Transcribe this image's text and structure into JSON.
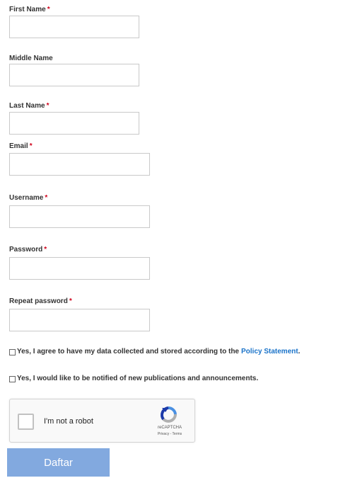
{
  "form": {
    "first_name_label": "First Name",
    "middle_name_label": "Middle Name",
    "last_name_label": "Last Name",
    "email_label": "Email",
    "username_label": "Username",
    "password_label": "Password",
    "repeat_password_label": "Repeat password",
    "required_mark": "*",
    "first_name_value": "",
    "middle_name_value": "",
    "last_name_value": "",
    "email_value": "",
    "username_value": "",
    "password_value": "",
    "repeat_password_value": ""
  },
  "consent": {
    "privacy_text": "Yes, I agree to have my data collected and stored according to the",
    "privacy_link": "Policy Statement",
    "privacy_suffix": ".",
    "notify_text": "Yes, I would like to be notified of new publications and announcements."
  },
  "captcha": {
    "label": "I'm not a robot",
    "brand": "reCAPTCHA",
    "links": "Privacy - Terms",
    "logo_icon": "recaptcha-logo-icon"
  },
  "submit": {
    "label": "Daftar"
  },
  "colors": {
    "required": "#d0021b",
    "link": "#1a73c9",
    "button": "#82a9df"
  }
}
